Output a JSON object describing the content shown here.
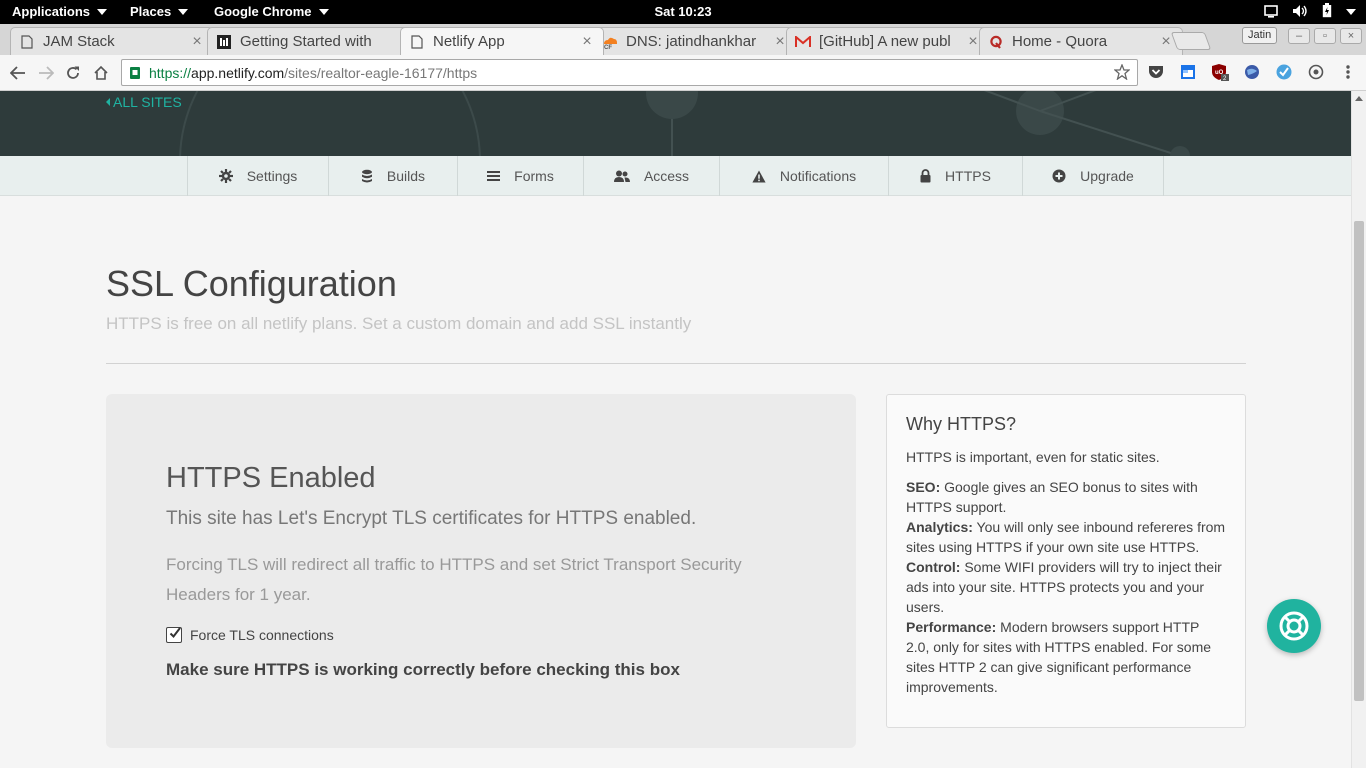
{
  "topbar": {
    "applications": "Applications",
    "places": "Places",
    "app": "Google Chrome",
    "clock": "Sat 10:23"
  },
  "tabs": [
    {
      "title": "JAM Stack",
      "favicon": "page-icon"
    },
    {
      "title": "Getting Started with",
      "favicon": "github-icon"
    },
    {
      "title": "Netlify App",
      "favicon": "page-icon",
      "active": true
    },
    {
      "title": "DNS: jatindhankhar",
      "favicon": "cloudflare-icon"
    },
    {
      "title": "[GitHub] A new publ",
      "favicon": "gmail-icon"
    },
    {
      "title": "Home - Quora",
      "favicon": "quora-icon"
    }
  ],
  "browser": {
    "profile": "Jatin",
    "url_scheme": "https://",
    "url_host": "app.netlify.com",
    "url_path": "/sites/realtor-eagle-16177/https"
  },
  "page": {
    "back_link": "ALL SITES",
    "nav": [
      {
        "label": "Settings",
        "icon": "gear-icon"
      },
      {
        "label": "Builds",
        "icon": "database-icon"
      },
      {
        "label": "Forms",
        "icon": "list-icon"
      },
      {
        "label": "Access",
        "icon": "users-icon"
      },
      {
        "label": "Notifications",
        "icon": "warning-icon"
      },
      {
        "label": "HTTPS",
        "icon": "lock-icon"
      },
      {
        "label": "Upgrade",
        "icon": "plus-circle-icon"
      }
    ],
    "title": "SSL Configuration",
    "subtitle": "HTTPS is free on all netlify plans. Set a custom domain and add SSL instantly",
    "panel": {
      "heading": "HTTPS Enabled",
      "lead": "This site has Let's Encrypt TLS certificates for HTTPS enabled.",
      "desc": "Forcing TLS will redirect all traffic to HTTPS and set Strict Transport Security Headers for 1 year.",
      "checkbox_label": "Force TLS connections",
      "checkbox_checked": true,
      "warning": "Make sure HTTPS is working correctly before checking this box"
    },
    "why": {
      "heading": "Why HTTPS?",
      "intro": "HTTPS is important, even for static sites.",
      "points": [
        {
          "term": "SEO:",
          "text": " Google gives an SEO bonus to sites with HTTPS support."
        },
        {
          "term": "Analytics:",
          "text": " You will only see inbound refereres from sites using HTTPS if your own site use HTTPS."
        },
        {
          "term": "Control:",
          "text": " Some WIFI providers will try to inject their ads into your site. HTTPS protects you and your users."
        },
        {
          "term": "Performance:",
          "text": " Modern browsers support HTTP 2.0, only for sites with HTTPS enabled. For some sites HTTP 2 can give significant performance improvements."
        }
      ]
    }
  },
  "colors": {
    "accent": "#1fb3a2",
    "hero": "#2e3b3b",
    "fab": "#20b39f"
  }
}
